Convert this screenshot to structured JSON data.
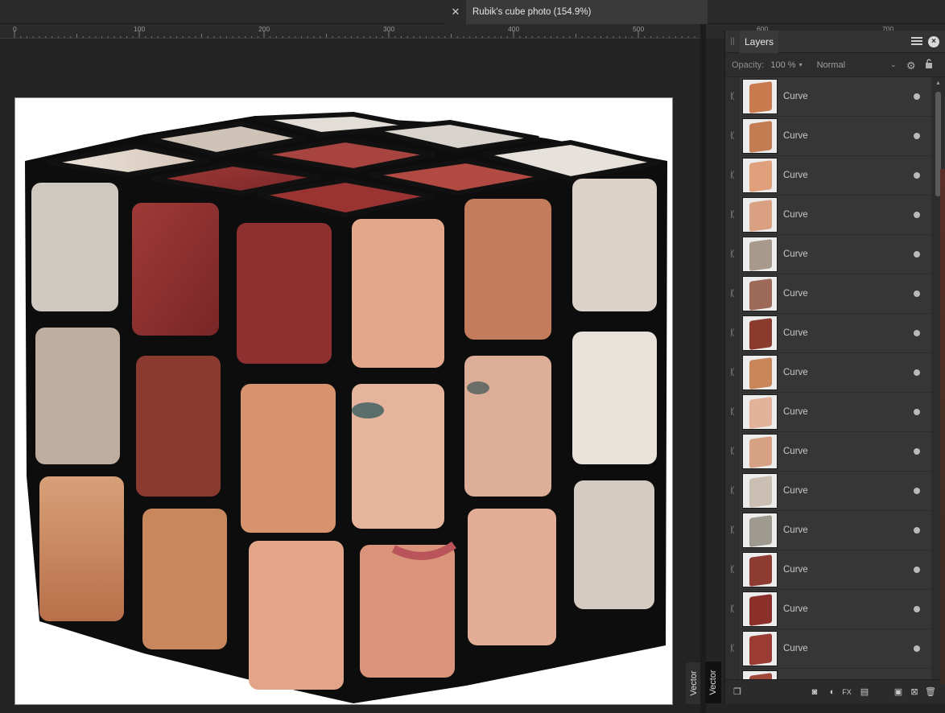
{
  "document_tab": {
    "close_glyph": "✕",
    "title": "Rubik's cube photo (154.9%)"
  },
  "ruler": {
    "labels": [
      "0",
      "100",
      "200",
      "300",
      "400",
      "500",
      "600",
      "700"
    ]
  },
  "side_tabs": {
    "left": "Vector",
    "right": "Vector"
  },
  "layers_panel": {
    "title": "Layers",
    "opacity_label": "Opacity:",
    "opacity_value": "100 %",
    "blend_mode": "Normal",
    "layers": [
      {
        "name": "Curve",
        "thumb_color": "#c97a4f"
      },
      {
        "name": "Curve",
        "thumb_color": "#c47d52"
      },
      {
        "name": "Curve",
        "thumb_color": "#e0a07c"
      },
      {
        "name": "Curve",
        "thumb_color": "#d9a182"
      },
      {
        "name": "Curve",
        "thumb_color": "#a79a8c"
      },
      {
        "name": "Curve",
        "thumb_color": "#9d6a5a"
      },
      {
        "name": "Curve",
        "thumb_color": "#8b3a2e"
      },
      {
        "name": "Curve",
        "thumb_color": "#c98659"
      },
      {
        "name": "Curve",
        "thumb_color": "#e3b29a"
      },
      {
        "name": "Curve",
        "thumb_color": "#d7a184"
      },
      {
        "name": "Curve",
        "thumb_color": "#cbbfb3"
      },
      {
        "name": "Curve",
        "thumb_color": "#9f9a8f"
      },
      {
        "name": "Curve",
        "thumb_color": "#8e3b32"
      },
      {
        "name": "Curve",
        "thumb_color": "#8a2f2a"
      },
      {
        "name": "Curve",
        "thumb_color": "#9a3c33"
      },
      {
        "name": "Curve",
        "thumb_color": "#a14a3c"
      }
    ]
  },
  "colors": {
    "app_bg": "#242424",
    "panel_bg": "#2d2d2d",
    "layer_row": "#363636",
    "cube_black": "#0d0d0d",
    "beret_red": "#8c2e2f",
    "skin": "#e3a98a",
    "hair": "#c98457"
  }
}
